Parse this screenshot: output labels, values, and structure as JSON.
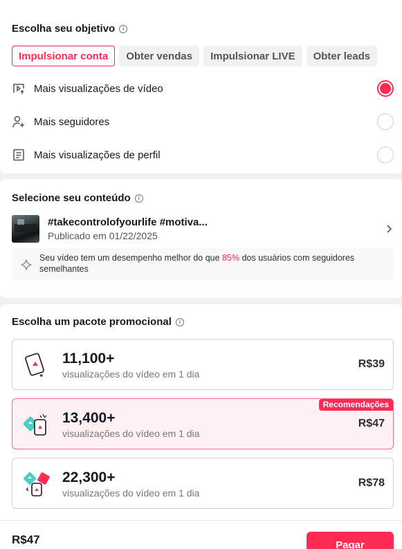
{
  "objective": {
    "title": "Escolha seu objetivo",
    "tabs": [
      {
        "label": "Impulsionar conta",
        "active": true
      },
      {
        "label": "Obter vendas",
        "active": false
      },
      {
        "label": "Impulsionar LIVE",
        "active": false
      },
      {
        "label": "Obter leads",
        "active": false
      }
    ],
    "options": [
      {
        "label": "Mais visualizações de vídeo",
        "icon": "video-play-icon",
        "selected": true
      },
      {
        "label": "Mais seguidores",
        "icon": "user-add-icon",
        "selected": false
      },
      {
        "label": "Mais visualizações de perfil",
        "icon": "profile-doc-icon",
        "selected": false
      }
    ]
  },
  "content": {
    "title": "Selecione seu conteúdo",
    "video": {
      "title": "#takecontrolofyourlife #motiva...",
      "date": "Publicado em 01/22/2025"
    },
    "insight": {
      "before": "Seu vídeo tem um desempenho melhor do que ",
      "percent": "85%",
      "after": " dos usuários com seguidores semelhantes"
    }
  },
  "packages": {
    "title": "Escolha um pacote promocional",
    "items": [
      {
        "views": "11,100+",
        "desc": "visualizações do vídeo em 1 dia",
        "price": "R$39",
        "selected": false,
        "badge": ""
      },
      {
        "views": "13,400+",
        "desc": "visualizações do vídeo em 1 dia",
        "price": "R$47",
        "selected": true,
        "badge": "Recomendações"
      },
      {
        "views": "22,300+",
        "desc": "visualizações do vídeo em 1 dia",
        "price": "R$78",
        "selected": false,
        "badge": ""
      }
    ]
  },
  "footer": {
    "total": "R$47",
    "pay_label": "Pagar"
  },
  "colors": {
    "accent": "#fe2c55",
    "teal": "#4ecdc4"
  }
}
